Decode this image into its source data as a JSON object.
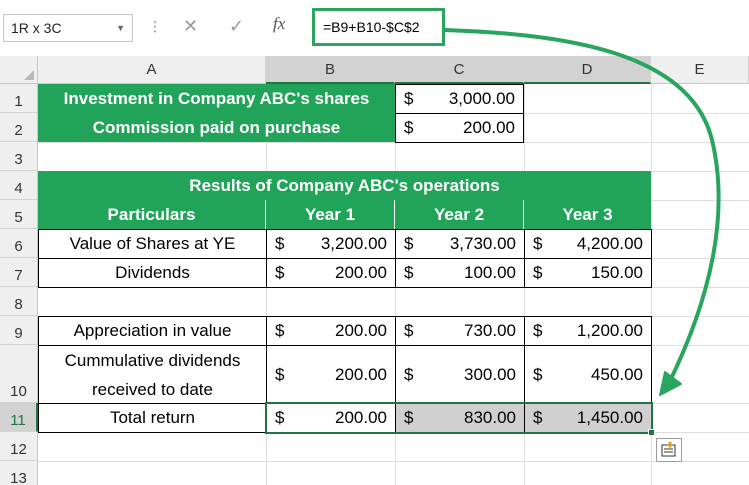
{
  "formula_bar": {
    "name_box": "1R x 3C",
    "formula": "=B9+B10-$C$2",
    "fx": "fx",
    "cancel_glyph": "✕",
    "enter_glyph": "✓"
  },
  "columns": [
    "A",
    "B",
    "C",
    "D",
    "E"
  ],
  "rows": [
    "1",
    "2",
    "3",
    "4",
    "5",
    "6",
    "7",
    "8",
    "9",
    "10",
    "11",
    "12",
    "13"
  ],
  "sheet": {
    "a1": "Investment in Company ABC's shares",
    "c1": {
      "cur": "$",
      "amt": "3,000.00"
    },
    "a2": "Commission paid on purchase",
    "c2": {
      "cur": "$",
      "amt": "200.00"
    },
    "results_title": "Results of Company ABC's operations",
    "hdr_particulars": "Particulars",
    "hdr_year1": "Year 1",
    "hdr_year2": "Year 2",
    "hdr_year3": "Year 3",
    "r6_label": "Value of Shares at YE",
    "r6": [
      {
        "cur": "$",
        "amt": "3,200.00"
      },
      {
        "cur": "$",
        "amt": "3,730.00"
      },
      {
        "cur": "$",
        "amt": "4,200.00"
      }
    ],
    "r7_label": "Dividends",
    "r7": [
      {
        "cur": "$",
        "amt": "200.00"
      },
      {
        "cur": "$",
        "amt": "100.00"
      },
      {
        "cur": "$",
        "amt": "150.00"
      }
    ],
    "r9_label": "Appreciation in value",
    "r9": [
      {
        "cur": "$",
        "amt": "200.00"
      },
      {
        "cur": "$",
        "amt": "730.00"
      },
      {
        "cur": "$",
        "amt": "1,200.00"
      }
    ],
    "r10_label_1": "Cummulative dividends",
    "r10_label_2": "received to date",
    "r10": [
      {
        "cur": "$",
        "amt": "200.00"
      },
      {
        "cur": "$",
        "amt": "300.00"
      },
      {
        "cur": "$",
        "amt": "450.00"
      }
    ],
    "r11_label": "Total return",
    "r11": [
      {
        "cur": "$",
        "amt": "200.00"
      },
      {
        "cur": "$",
        "amt": "830.00"
      },
      {
        "cur": "$",
        "amt": "1,450.00"
      }
    ]
  },
  "colors": {
    "header_green": "#21a45a",
    "selection_green": "#217346",
    "arrow_green": "#2aa55f",
    "selected_fill": "#d0d0d0"
  },
  "icons": {
    "quick_analysis": "quick-analysis-icon"
  }
}
